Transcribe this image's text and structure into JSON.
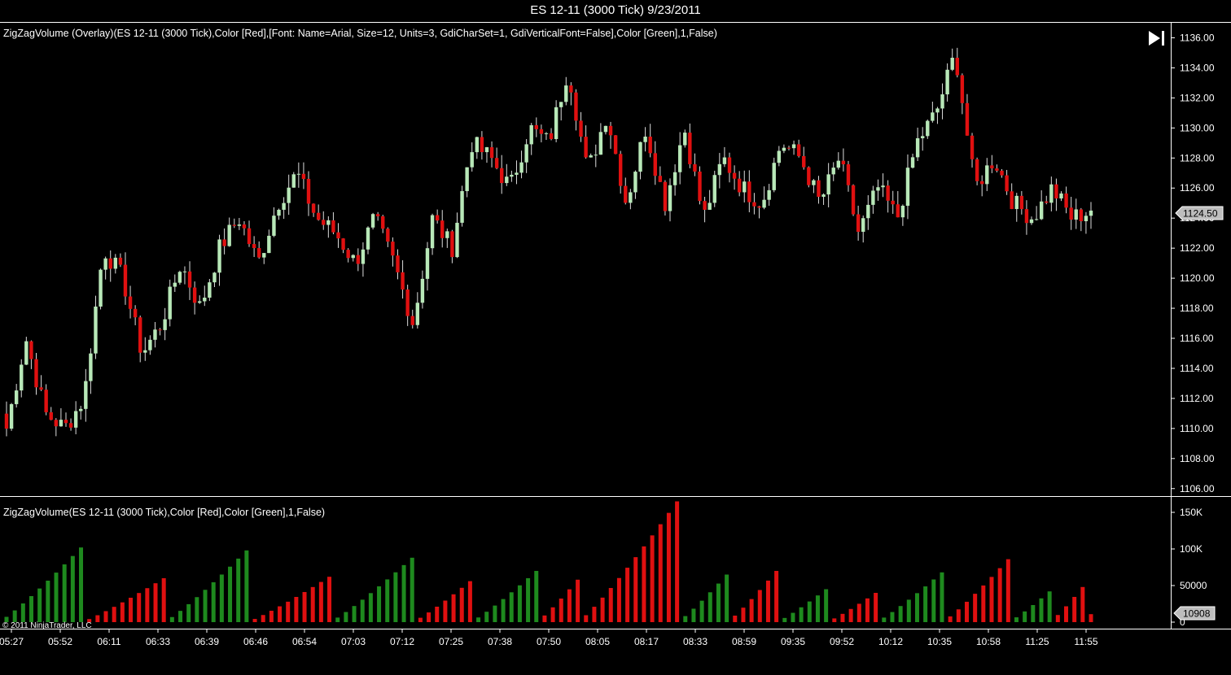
{
  "window": {
    "title": "ES 12-11 (3000 Tick)  9/23/2011"
  },
  "colors": {
    "up": "#b8e8b8",
    "down": "#e01010",
    "vol_up": "#1e8a1e",
    "vol_down": "#e01010",
    "axis": "#ffffff",
    "background": "#000000"
  },
  "price_panel": {
    "label": "ZigZagVolume (Overlay)(ES 12-11 (3000 Tick),Color [Red],[Font: Name=Arial, Size=12, Units=3, GdiCharSet=1, GdiVerticalFont=False],Color [Green],1,False)",
    "last_price_label": "1124.50",
    "end_icon": "skip-to-end-icon"
  },
  "volume_panel": {
    "label": "ZigZagVolume(ES 12-11 (3000 Tick),Color [Red],Color [Green],1,False)",
    "last_volume_label": "10908"
  },
  "copyright": "© 2011 NinjaTrader, LLC",
  "chart_data": [
    {
      "type": "candlestick",
      "title": "ES 12-11 (3000 Tick)",
      "ylim": [
        1105.5,
        1137.0
      ],
      "y_ticks": [
        "1106.00",
        "1108.00",
        "1110.00",
        "1112.00",
        "1114.00",
        "1116.00",
        "1118.00",
        "1120.00",
        "1122.00",
        "1124.00",
        "1126.00",
        "1128.00",
        "1130.00",
        "1132.00",
        "1134.00",
        "1136.00"
      ],
      "x_ticks": [
        "05:27",
        "05:52",
        "06:11",
        "06:33",
        "06:39",
        "06:46",
        "06:54",
        "07:03",
        "07:12",
        "07:25",
        "07:38",
        "07:50",
        "08:05",
        "08:17",
        "08:33",
        "08:59",
        "09:35",
        "09:52",
        "10:12",
        "10:35",
        "10:58",
        "11:25",
        "11:55"
      ],
      "close_path": [
        1110,
        1116,
        1111,
        1110,
        1112,
        1122,
        1120,
        1115,
        1117,
        1121,
        1118,
        1122,
        1124,
        1121,
        1125,
        1127,
        1124,
        1123,
        1121,
        1124,
        1121,
        1117,
        1124,
        1122,
        1129,
        1128,
        1126,
        1130,
        1129,
        1134,
        1127,
        1131,
        1125,
        1130,
        1125,
        1130,
        1124,
        1128,
        1126,
        1125,
        1129,
        1128,
        1125,
        1128,
        1123,
        1126,
        1124,
        1129,
        1131,
        1135,
        1126,
        1128,
        1125,
        1124,
        1126,
        1124,
        1124.5
      ],
      "last_price": 1124.5
    },
    {
      "type": "bar",
      "title": "ZigZagVolume",
      "ylim": [
        0,
        170000
      ],
      "y_ticks": [
        "0",
        "50000",
        "100K",
        "150K"
      ],
      "swings": [
        {
          "dir": "up",
          "n": 10,
          "peak": 102000
        },
        {
          "dir": "down",
          "n": 10,
          "peak": 60000
        },
        {
          "dir": "up",
          "n": 10,
          "peak": 98000
        },
        {
          "dir": "down",
          "n": 10,
          "peak": 62000
        },
        {
          "dir": "up",
          "n": 10,
          "peak": 88000
        },
        {
          "dir": "down",
          "n": 7,
          "peak": 56000
        },
        {
          "dir": "up",
          "n": 8,
          "peak": 70000
        },
        {
          "dir": "down",
          "n": 5,
          "peak": 58000
        },
        {
          "dir": "down",
          "n": 12,
          "peak": 165000
        },
        {
          "dir": "up",
          "n": 6,
          "peak": 65000
        },
        {
          "dir": "down",
          "n": 6,
          "peak": 70000
        },
        {
          "dir": "up",
          "n": 6,
          "peak": 45000
        },
        {
          "dir": "down",
          "n": 6,
          "peak": 40000
        },
        {
          "dir": "up",
          "n": 8,
          "peak": 68000
        },
        {
          "dir": "down",
          "n": 8,
          "peak": 86000
        },
        {
          "dir": "up",
          "n": 5,
          "peak": 42000
        },
        {
          "dir": "down",
          "n": 4,
          "peak": 48000
        }
      ],
      "last_value": 10908
    }
  ]
}
